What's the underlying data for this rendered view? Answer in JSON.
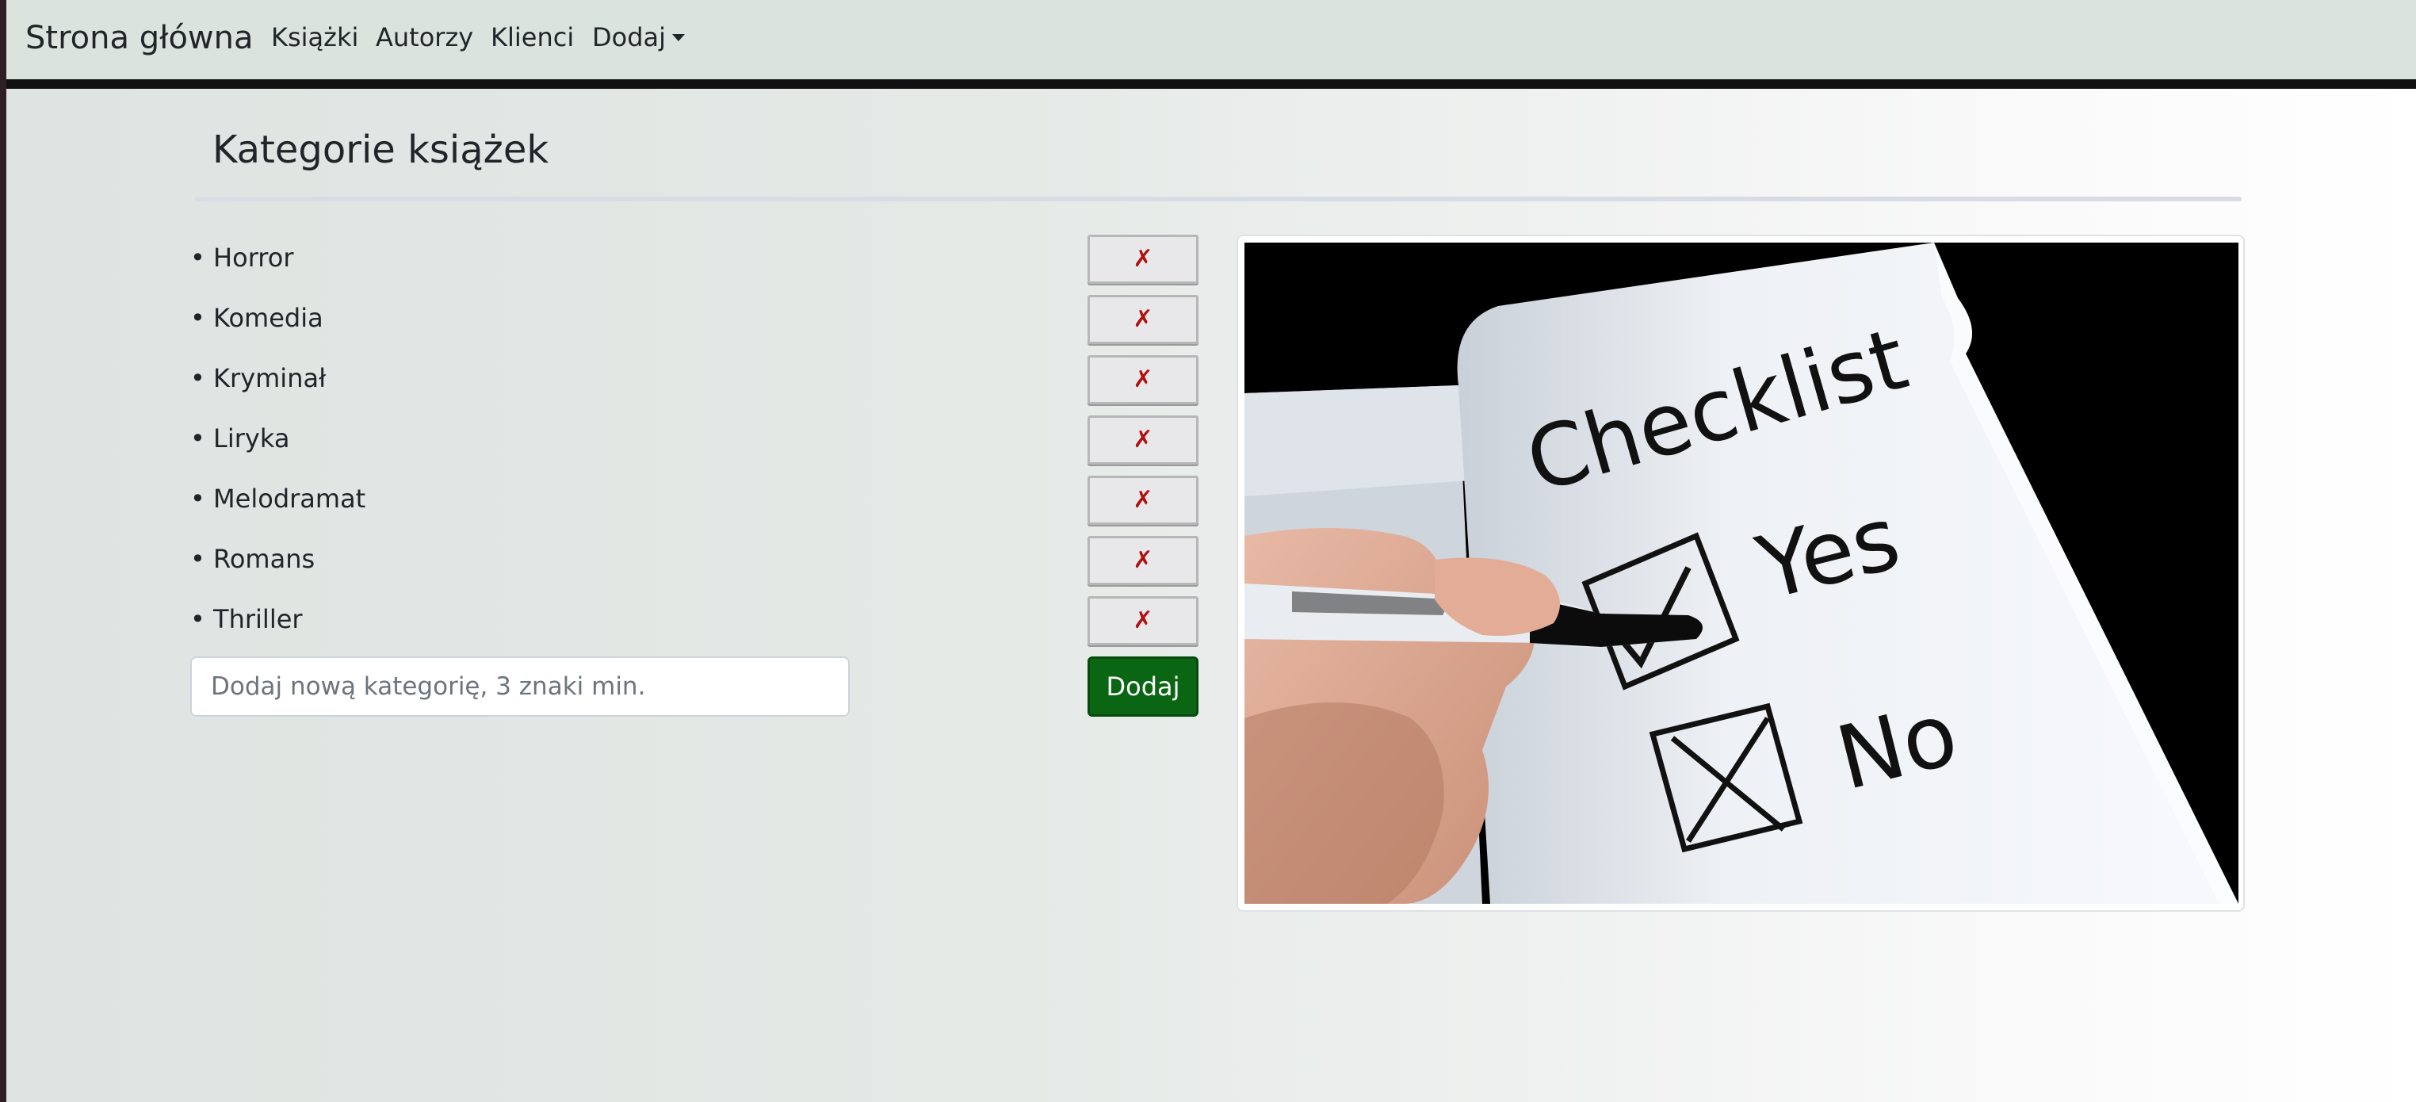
{
  "navbar": {
    "brand": "Strona główna",
    "links": [
      {
        "label": "Książki"
      },
      {
        "label": "Autorzy"
      },
      {
        "label": "Klienci"
      },
      {
        "label": "Dodaj"
      }
    ]
  },
  "page": {
    "title": "Kategorie książek"
  },
  "categories": [
    {
      "label": "• Horror"
    },
    {
      "label": "• Komedia"
    },
    {
      "label": "• Kryminał"
    },
    {
      "label": "• Liryka"
    },
    {
      "label": "• Melodramat"
    },
    {
      "label": "• Romans"
    },
    {
      "label": "• Thriller"
    }
  ],
  "delete_icon": "✗",
  "add_form": {
    "placeholder": "Dodaj nową kategorię, 3 znaki min.",
    "value": "",
    "button_label": "Dodaj"
  },
  "illustration": {
    "heading": "Checklist",
    "option_yes": "Yes",
    "option_no": "No"
  },
  "colors": {
    "navbar_bg": "#dbe3de",
    "add_button": "#0b6614",
    "delete_icon": "#b01010"
  }
}
